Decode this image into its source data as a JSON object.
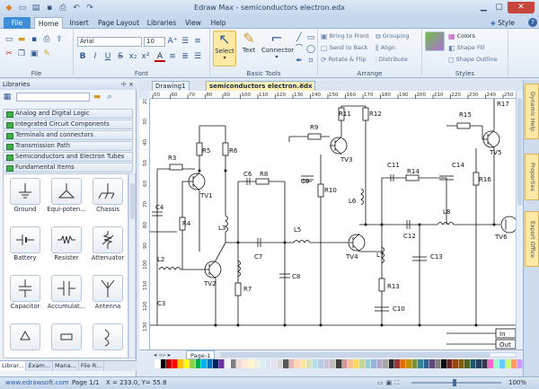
{
  "window": {
    "title": "Edraw Max - semiconductors electron.edx",
    "style_label": "Style",
    "help_icon": "?"
  },
  "tabs": [
    {
      "label": "File"
    },
    {
      "label": "Home"
    },
    {
      "label": "Insert"
    },
    {
      "label": "Page Layout"
    },
    {
      "label": "Libraries"
    },
    {
      "label": "View"
    },
    {
      "label": "Help"
    }
  ],
  "ribbon": {
    "file_label": "File",
    "font_label": "Font",
    "basic_tools_label": "Basic Tools",
    "arrange_label": "Arrange",
    "styles_label": "Styles",
    "font_name": "Arial",
    "font_size": "10",
    "select": "Select",
    "text": "Text",
    "connector": "Connector",
    "bring_front": "Bring to Front",
    "send_back": "Send to Back",
    "rotate_flip": "Rotate & Flip",
    "grouping": "Grouping",
    "align": "Align",
    "distribute": "Distribute",
    "colors": "Colors",
    "shape_fill": "Shape Fill",
    "shape_outline": "Shape Outline",
    "bold": "B",
    "italic": "I",
    "underline": "U",
    "strike": "S",
    "font_color": "A"
  },
  "libraries": {
    "header": "Libraries",
    "pin": "☩ ×",
    "items": [
      "Analog and Digital Logic",
      "Integrated Circuit Components",
      "Terminals and connectors",
      "Transmission Path",
      "Semiconductors and Electron Tubes",
      "Fundamental Items"
    ],
    "shapes": [
      "Ground",
      "Equi-poten...",
      "Chassis",
      "Battery",
      "Resister",
      "Attenuator",
      "Capacitor",
      "Accumulat...",
      "Antenna",
      "",
      ""
    ],
    "bottom_tabs": [
      "Librar...",
      "Exam...",
      "Mana...",
      "File R..."
    ]
  },
  "documents": {
    "tabs": [
      "Drawing1",
      "semiconductors electron.edx"
    ]
  },
  "ruler": {
    "h": [
      "50",
      "60",
      "70",
      "80",
      "90",
      "100",
      "110",
      "120",
      "130",
      "140",
      "150",
      "160",
      "170",
      "180",
      "190",
      "200",
      "210",
      "220",
      "230",
      "240",
      "250"
    ],
    "v": [
      "20",
      "30",
      "40",
      "50",
      "60",
      "70",
      "80",
      "90",
      "100",
      "110",
      "120",
      "130"
    ]
  },
  "diagram": {
    "labels": [
      "R3",
      "R5",
      "R6",
      "TV1",
      "C4",
      "R4",
      "C6",
      "R8",
      "L3",
      "C7",
      "L2",
      "TV2",
      "R7",
      "C8",
      "C3",
      "R9",
      "R11",
      "R12",
      "TV3",
      "C9",
      "R10",
      "L6",
      "L5",
      "TV4",
      "C11",
      "R14",
      "C14",
      "L8",
      "C12",
      "L7",
      "C13",
      "R13",
      "C10",
      "R15",
      "TV5",
      "R16",
      "TV6",
      "R17",
      "In",
      "Out"
    ]
  },
  "sidepanel": [
    "Dynamic Help",
    "Properties",
    "Export Office"
  ],
  "pagebar": {
    "page": "Page-1"
  },
  "status": {
    "website": "www.edrawsoft.com",
    "page": "Page 1/1",
    "coords": "X = 233.0, Y= 55.8",
    "zoom": "100%"
  },
  "colors": {
    "palette": [
      "#ffffff",
      "#000000",
      "#c00000",
      "#ff0000",
      "#ffc000",
      "#ffff00",
      "#92d050",
      "#00b050",
      "#00b0f0",
      "#0070c0",
      "#002060",
      "#7030a0",
      "#f2f2f2",
      "#808080",
      "#f2dcdb",
      "#fde9d9",
      "#fff2cc",
      "#ebf1dd",
      "#dbeef3",
      "#dbe5f1",
      "#e5e0ec",
      "#d8d8d8",
      "#595959",
      "#e6b8b7",
      "#fbd5b5",
      "#ffe599",
      "#d7e3bc",
      "#b7dde8",
      "#b8cce4",
      "#ccc1d9",
      "#bfbfbf",
      "#404040",
      "#d99694",
      "#fac08f",
      "#ffd966",
      "#c3d69b",
      "#92cddc",
      "#95b3d7",
      "#b2a2c7",
      "#a5a5a5",
      "#262626",
      "#953734",
      "#e36c09",
      "#bf9000",
      "#76923c",
      "#31859b",
      "#366092",
      "#5f497a",
      "#7f7f7f",
      "#0d0d0d",
      "#632423",
      "#974806",
      "#7f6000",
      "#4f6228",
      "#205867",
      "#244061",
      "#3f3151",
      "#ff66cc",
      "#99ffcc",
      "#66ccff",
      "#ccff66",
      "#ff9966",
      "#cc99ff"
    ]
  }
}
